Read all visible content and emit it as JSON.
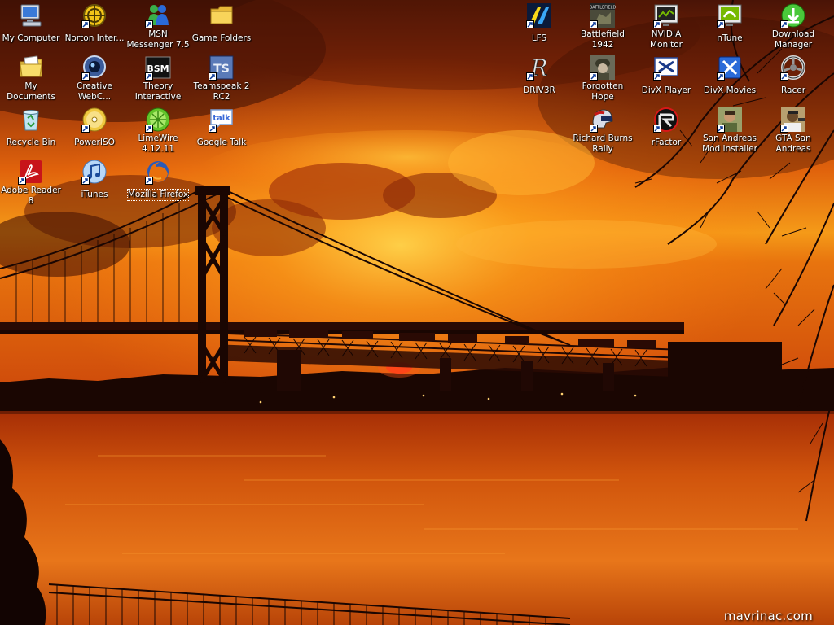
{
  "desktop": {
    "left_icons": [
      {
        "label": "My Computer",
        "icon": "my-computer-icon",
        "shortcut": false
      },
      {
        "label": "My Documents",
        "icon": "my-documents-icon",
        "shortcut": false
      },
      {
        "label": "Recycle Bin",
        "icon": "recycle-bin-icon",
        "shortcut": false
      },
      {
        "label": "Adobe Reader 8",
        "icon": "adobe-reader-icon",
        "shortcut": true
      },
      {
        "label": "Norton Inter...",
        "icon": "norton-icon",
        "shortcut": true
      },
      {
        "label": "Creative WebC...",
        "icon": "webcam-icon",
        "shortcut": true
      },
      {
        "label": "PowerISO",
        "icon": "poweriso-icon",
        "shortcut": true
      },
      {
        "label": "iTunes",
        "icon": "itunes-icon",
        "shortcut": true
      },
      {
        "label": "MSN Messenger 7.5",
        "icon": "msn-messenger-icon",
        "shortcut": true
      },
      {
        "label": "Theory Interactive",
        "icon": "bsm-icon",
        "shortcut": true
      },
      {
        "label": "LimeWire 4.12.11",
        "icon": "limewire-icon",
        "shortcut": true
      },
      {
        "label": "Mozilla Firefox",
        "icon": "firefox-icon",
        "shortcut": true,
        "selected": true
      },
      {
        "label": "Game Folders",
        "icon": "folder-icon",
        "shortcut": false
      },
      {
        "label": "Teamspeak 2 RC2",
        "icon": "teamspeak-icon",
        "shortcut": true
      },
      {
        "label": "Google Talk",
        "icon": "google-talk-icon",
        "shortcut": true
      }
    ],
    "right_icons": [
      {
        "label": "LFS",
        "icon": "lfs-icon",
        "shortcut": true
      },
      {
        "label": "DRIV3R",
        "icon": "driv3r-icon",
        "shortcut": true
      },
      {
        "label": "Battlefield 1942",
        "icon": "battlefield-icon",
        "shortcut": true
      },
      {
        "label": "Forgotten Hope",
        "icon": "forgotten-hope-icon",
        "shortcut": true
      },
      {
        "label": "Richard Burns Rally",
        "icon": "rally-helmet-icon",
        "shortcut": true
      },
      {
        "label": "NVIDIA Monitor",
        "icon": "nvidia-monitor-icon",
        "shortcut": true
      },
      {
        "label": "DivX Player",
        "icon": "divx-player-icon",
        "shortcut": true
      },
      {
        "label": "rFactor",
        "icon": "rfactor-icon",
        "shortcut": true
      },
      {
        "label": "nTune",
        "icon": "ntune-icon",
        "shortcut": true
      },
      {
        "label": "DivX Movies",
        "icon": "divx-movies-icon",
        "shortcut": true
      },
      {
        "label": "San Andreas Mod Installer",
        "icon": "sa-mod-installer-icon",
        "shortcut": true
      },
      {
        "label": "Download Manager",
        "icon": "download-manager-icon",
        "shortcut": true
      },
      {
        "label": "Racer",
        "icon": "racer-wheel-icon",
        "shortcut": true
      },
      {
        "label": "GTA San Andreas",
        "icon": "gta-sa-icon",
        "shortcut": true
      }
    ],
    "watermark": "mavrinac.com"
  }
}
